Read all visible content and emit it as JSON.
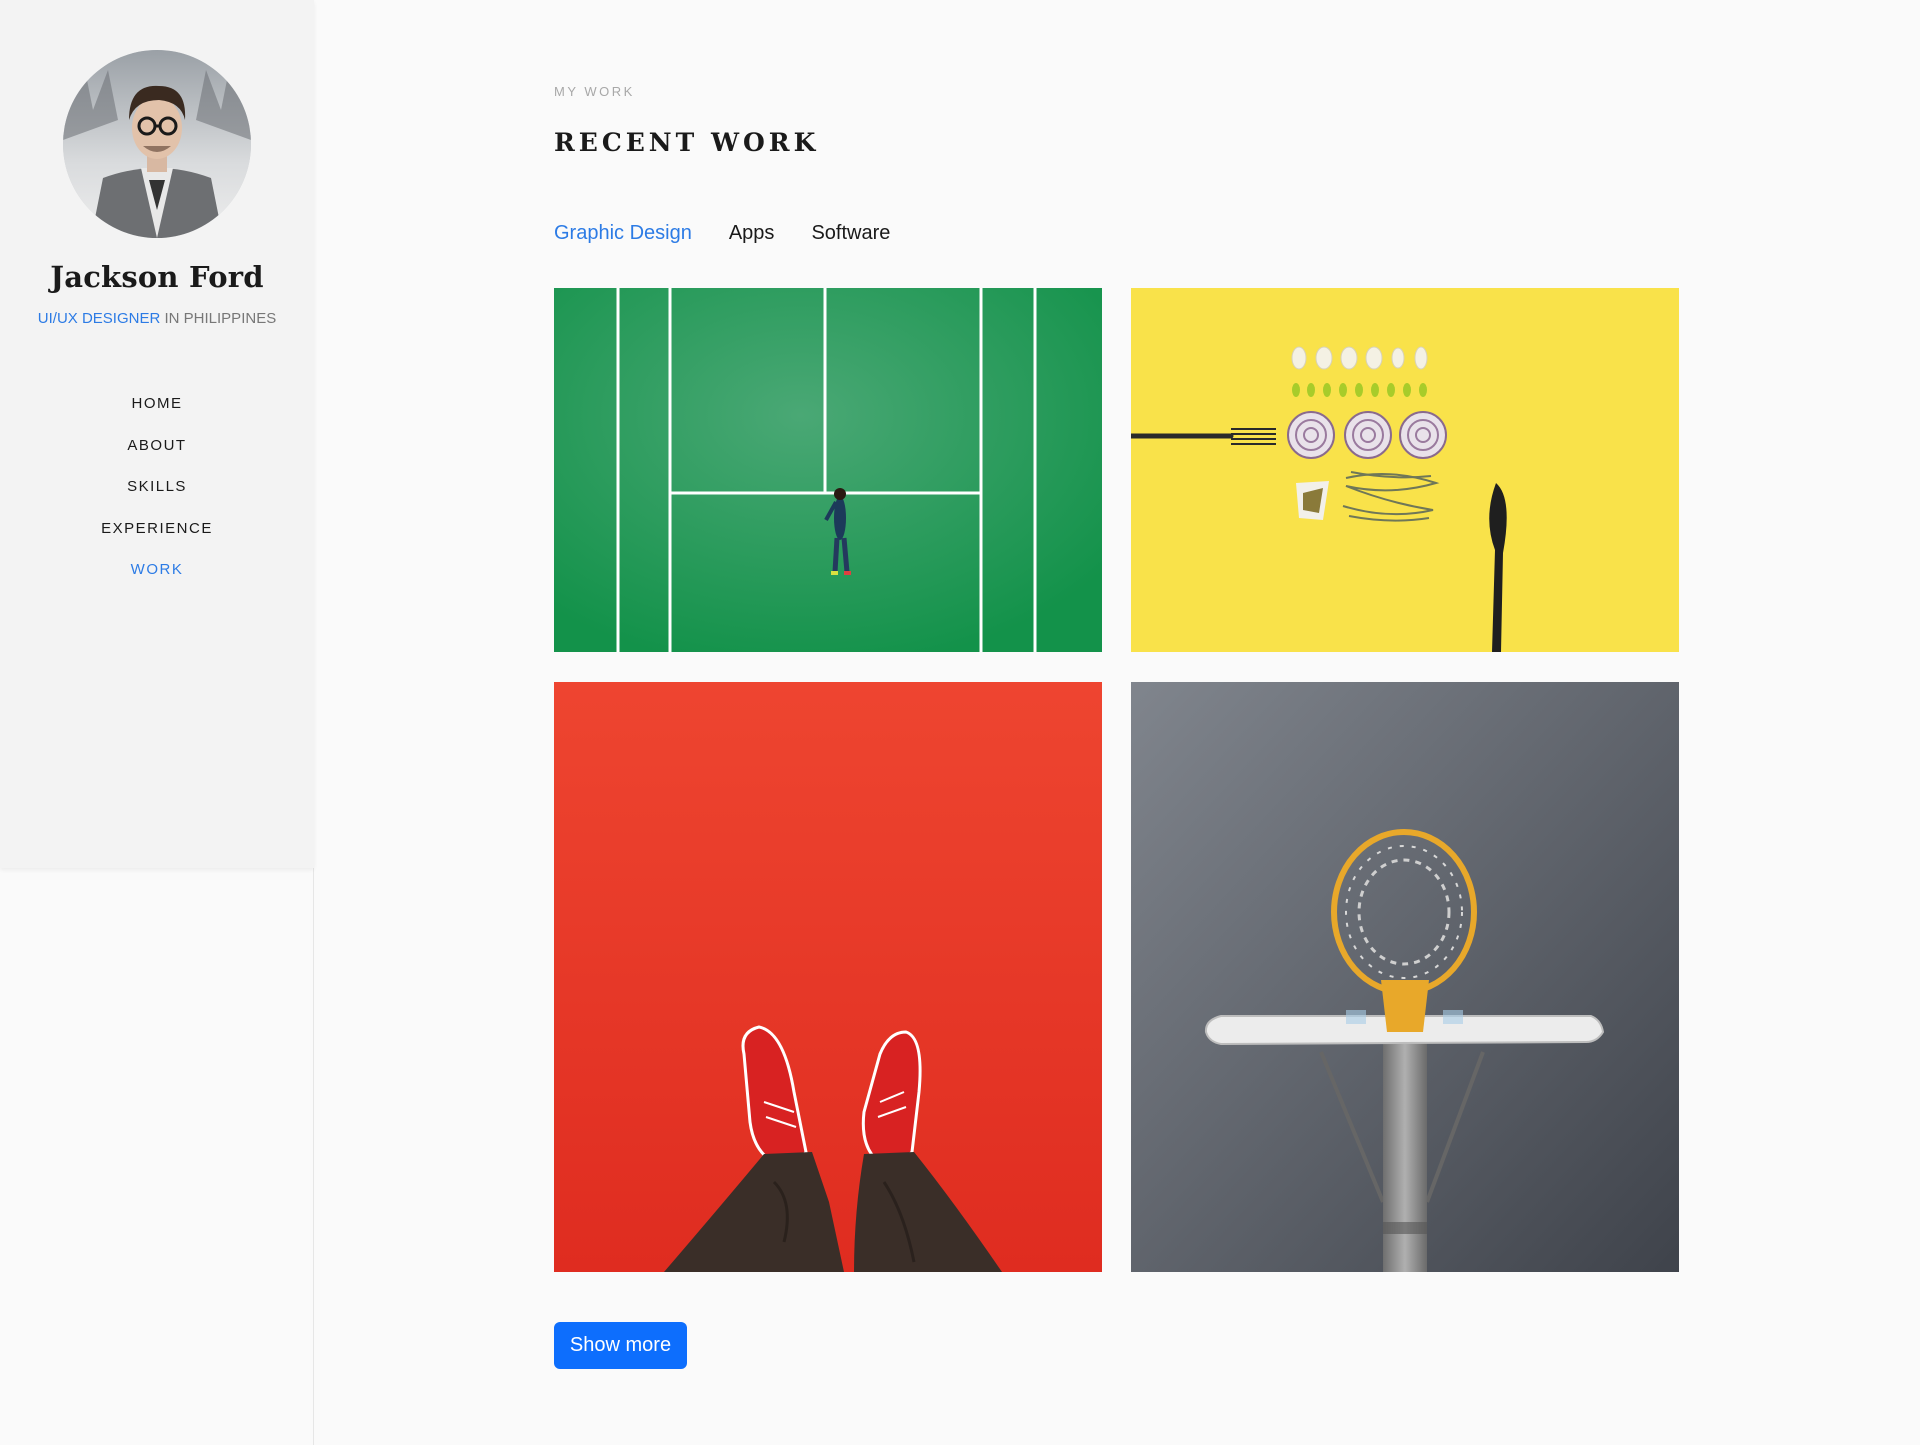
{
  "profile": {
    "name": "Jackson Ford",
    "role_accent": "UI/UX DESIGNER",
    "role_rest": " IN PHILIPPINES"
  },
  "nav": {
    "items": [
      {
        "label": "HOME",
        "active": false
      },
      {
        "label": "ABOUT",
        "active": false
      },
      {
        "label": "SKILLS",
        "active": false
      },
      {
        "label": "EXPERIENCE",
        "active": false
      },
      {
        "label": "WORK",
        "active": true
      }
    ]
  },
  "section": {
    "eyebrow": "MY WORK",
    "title": "RECENT WORK"
  },
  "tabs": [
    {
      "label": "Graphic Design",
      "active": true
    },
    {
      "label": "Apps",
      "active": false
    },
    {
      "label": "Software",
      "active": false
    }
  ],
  "gallery": [
    {
      "subject": "tennis-court-green"
    },
    {
      "subject": "food-flatlay-yellow"
    },
    {
      "subject": "red-sneakers"
    },
    {
      "subject": "basketball-hoop-grey"
    }
  ],
  "actions": {
    "show_more": "Show more"
  },
  "colors": {
    "accent": "#2c7be5",
    "button": "#0d6efd"
  }
}
